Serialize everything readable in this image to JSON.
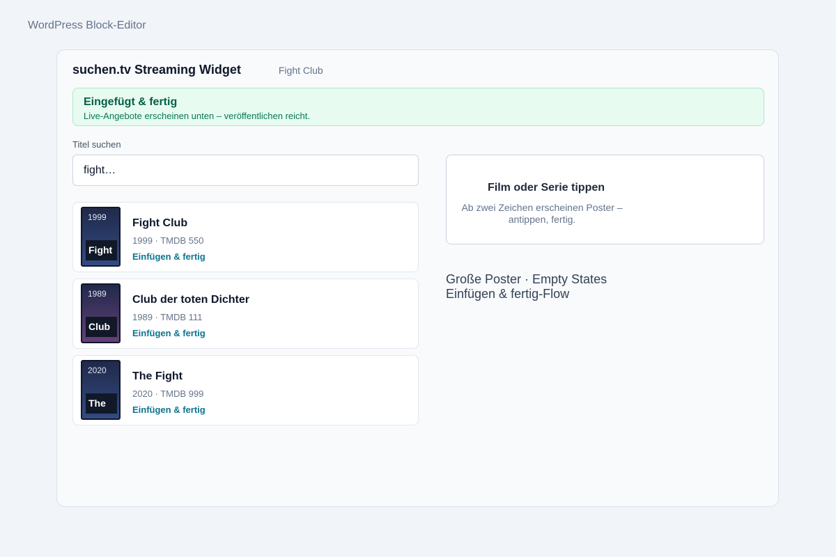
{
  "app": {
    "label": "WordPress Block-Editor"
  },
  "widget": {
    "title": "suchen.tv Streaming Widget",
    "selected_title": "Fight Club"
  },
  "success": {
    "title": "Eingefügt & fertig",
    "text": "Live-Angebote erscheinen unten – veröffentlichen reicht."
  },
  "search": {
    "label": "Titel suchen",
    "value": "fight…",
    "placeholder": ""
  },
  "results": [
    {
      "poster_year": "1999",
      "poster_word": "Fight",
      "poster_color": "#344a83",
      "title": "Fight Club",
      "meta": "1999 · TMDB 550",
      "action": "Einfügen & fertig"
    },
    {
      "poster_year": "1989",
      "poster_word": "Club",
      "poster_color": "#673f7a",
      "title": "Club der toten Dichter",
      "meta": "1989 · TMDB 111",
      "action": "Einfügen & fertig"
    },
    {
      "poster_year": "2020",
      "poster_word": "The",
      "poster_color": "#344a83",
      "title": "The Fight",
      "meta": "2020 · TMDB 999",
      "action": "Einfügen & fertig"
    }
  ],
  "preview": {
    "title": "Film oder Serie tippen",
    "text": "Ab zwei Zeichen erscheinen Poster – antippen, fertig."
  },
  "features": {
    "line1": "Große Poster · Empty States",
    "line2": "Einfügen & fertig-Flow"
  }
}
